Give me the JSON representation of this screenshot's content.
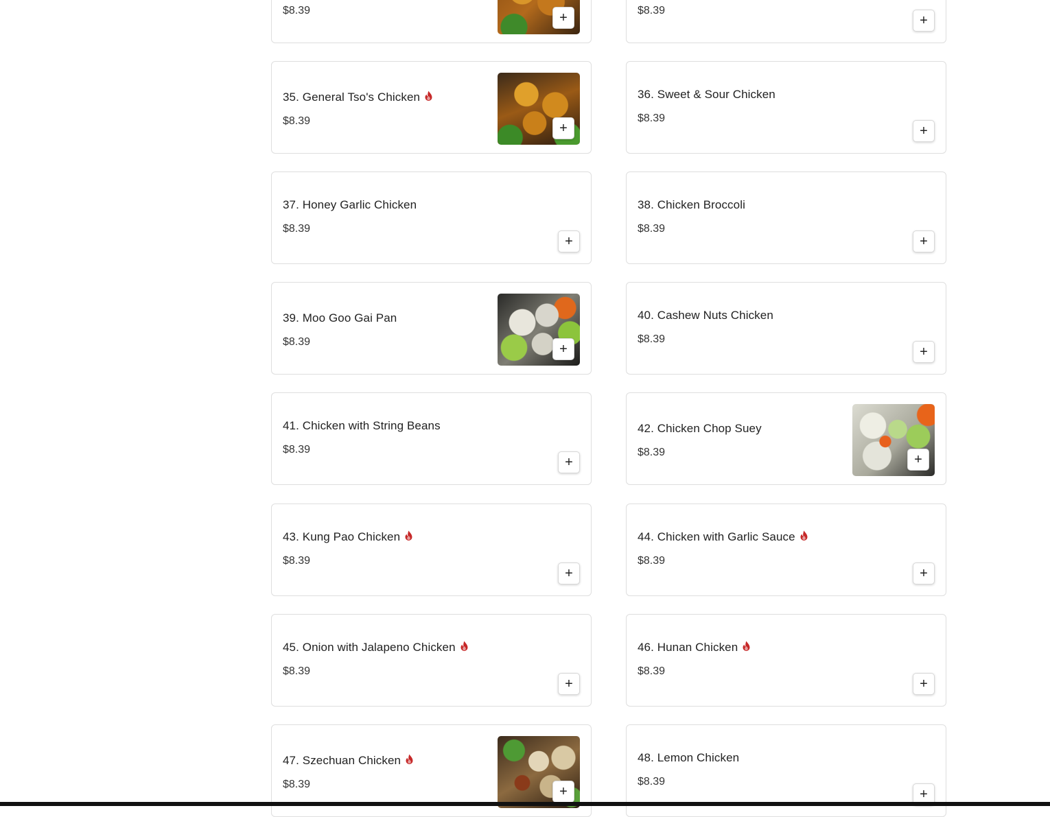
{
  "menu": {
    "items": [
      {
        "name": "",
        "price": "$8.39",
        "spicy": false,
        "image": "food-photo-general-tso"
      },
      {
        "name": "",
        "price": "$8.39",
        "spicy": false,
        "image": null
      },
      {
        "name": "35. General Tso's Chicken",
        "price": "$8.39",
        "spicy": true,
        "image": "food-photo-general-tso"
      },
      {
        "name": "36. Sweet & Sour Chicken",
        "price": "$8.39",
        "spicy": false,
        "image": null
      },
      {
        "name": "37. Honey Garlic Chicken",
        "price": "$8.39",
        "spicy": false,
        "image": null
      },
      {
        "name": "38. Chicken Broccoli",
        "price": "$8.39",
        "spicy": false,
        "image": null
      },
      {
        "name": "39. Moo Goo Gai Pan",
        "price": "$8.39",
        "spicy": false,
        "image": "food-photo-moo-goo-gai-pan"
      },
      {
        "name": "40. Cashew Nuts Chicken",
        "price": "$8.39",
        "spicy": false,
        "image": null
      },
      {
        "name": "41. Chicken with String Beans",
        "price": "$8.39",
        "spicy": false,
        "image": null
      },
      {
        "name": "42. Chicken Chop Suey",
        "price": "$8.39",
        "spicy": false,
        "image": "food-photo-chop-suey"
      },
      {
        "name": "43. Kung Pao Chicken",
        "price": "$8.39",
        "spicy": true,
        "image": null
      },
      {
        "name": "44. Chicken with Garlic Sauce",
        "price": "$8.39",
        "spicy": true,
        "image": null
      },
      {
        "name": "45. Onion with Jalapeno Chicken",
        "price": "$8.39",
        "spicy": true,
        "image": null
      },
      {
        "name": "46. Hunan Chicken",
        "price": "$8.39",
        "spicy": true,
        "image": null
      },
      {
        "name": "47. Szechuan Chicken",
        "price": "$8.39",
        "spicy": true,
        "image": "food-photo-szechuan"
      },
      {
        "name": "48. Lemon Chicken",
        "price": "$8.39",
        "spicy": false,
        "image": null
      }
    ],
    "add_label": "+",
    "spicy_icon": "flame-icon"
  },
  "colors": {
    "spicy": "#c62828",
    "card_border": "#dedede",
    "text": "#222222"
  }
}
